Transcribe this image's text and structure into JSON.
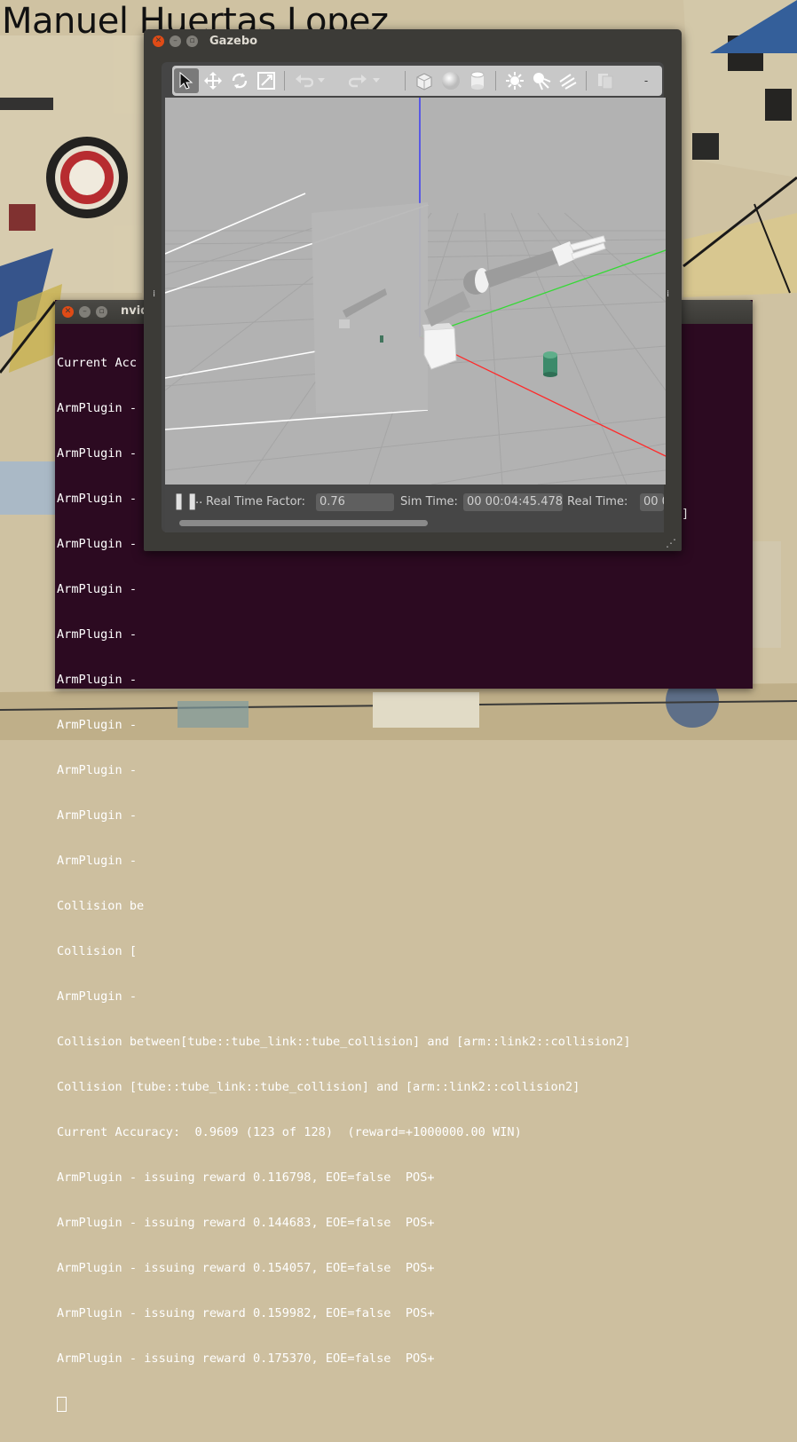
{
  "desktop": {
    "label": "Manuel Huertas Lopez"
  },
  "terminal": {
    "title": "nvid",
    "lines": [
      "Current Acc",
      "ArmPlugin -",
      "ArmPlugin -",
      "ArmPlugin -",
      "ArmPlugin -",
      "ArmPlugin -",
      "ArmPlugin -",
      "ArmPlugin -",
      "ArmPlugin -",
      "ArmPlugin -",
      "ArmPlugin -",
      "ArmPlugin -",
      "Collision be",
      "Collision [",
      "ArmPlugin -",
      "Collision between[tube::tube_link::tube_collision] and [arm::link2::collision2]",
      "Collision [tube::tube_link::tube_collision] and [arm::link2::collision2]",
      "Current Accuracy:  0.9609 (123 of 128)  (reward=+1000000.00 WIN)",
      "ArmPlugin - issuing reward 0.116798, EOE=false  POS+",
      "ArmPlugin - issuing reward 0.144683, EOE=false  POS+",
      "ArmPlugin - issuing reward 0.154057, EOE=false  POS+",
      "ArmPlugin - issuing reward 0.159982, EOE=false  POS+",
      "ArmPlugin - issuing reward 0.175370, EOE=false  POS+"
    ],
    "partial_line_right": "]"
  },
  "gazebo": {
    "title": "Gazebo",
    "toolbar": {
      "tools": [
        "select-arrow-icon",
        "translate-icon",
        "rotate-icon",
        "scale-icon",
        "undo-icon",
        "dropdown-icon",
        "redo-icon",
        "dropdown-icon",
        "box-icon",
        "sphere-icon",
        "cylinder-icon",
        "sun-light-icon",
        "spot-light-icon",
        "directional-light-icon",
        "copy-icon",
        "more-icon"
      ]
    },
    "status": {
      "pause_glyph": "❚❚",
      "step_glyph": "..",
      "rtf_label": "Real Time Factor:",
      "rtf_value": "0.76",
      "sim_time_label": "Sim Time:",
      "sim_time_value": "00 00:04:45.478",
      "real_time_label": "Real Time:",
      "real_time_value": "00 0"
    },
    "handles": {
      "left": "⁞",
      "right": "⁞"
    },
    "resize_grip": "⋰"
  },
  "colors": {
    "terminal_bg": "#2c0a21",
    "scene_bg": "#b2b2b2",
    "close_button": "#df4b16",
    "cylinder": "#3c8a6a",
    "axis_x": "#ff2a2a",
    "axis_y": "#36d936",
    "axis_z": "#2a2aff"
  }
}
